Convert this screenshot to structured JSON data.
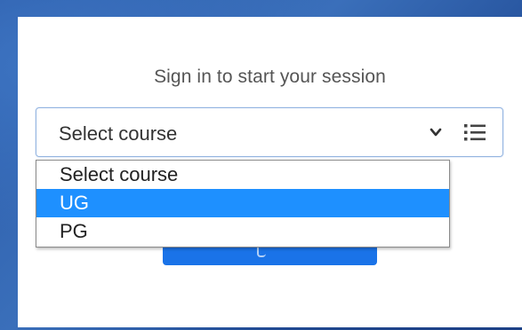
{
  "login": {
    "heading": "Sign in to start your session"
  },
  "course_select": {
    "selected_value": "Select course",
    "icon_chevron": "chevron-down-icon",
    "icon_list": "list-icon",
    "options": [
      {
        "label": "Select course",
        "highlighted": false
      },
      {
        "label": "UG",
        "highlighted": true
      },
      {
        "label": "PG",
        "highlighted": false
      }
    ]
  },
  "colors": {
    "accent": "#1a73e8",
    "highlight": "#1e90ff",
    "background": "#2c5aa5"
  }
}
